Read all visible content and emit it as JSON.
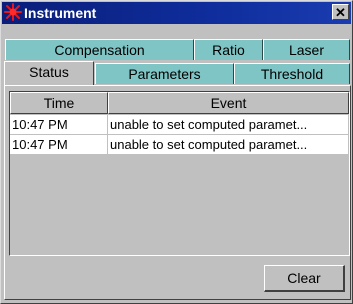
{
  "window": {
    "title": "Instrument",
    "close_symbol": "✕",
    "icon": "red-starburst-icon"
  },
  "tabs": {
    "row_back": [
      {
        "label": "Compensation"
      },
      {
        "label": "Ratio"
      },
      {
        "label": "Laser"
      }
    ],
    "row_front": [
      {
        "label": "Status",
        "active": true
      },
      {
        "label": "Parameters"
      },
      {
        "label": "Threshold"
      }
    ]
  },
  "table": {
    "columns": [
      "Time",
      "Event"
    ],
    "rows": [
      {
        "time": "10:47 PM",
        "event": "unable to set computed paramet..."
      },
      {
        "time": "10:47 PM",
        "event": "unable to set computed paramet..."
      }
    ]
  },
  "buttons": {
    "clear_label": "Clear"
  },
  "colors": {
    "titlebar": "#0f2d9c",
    "tab_inactive": "#7fc5c5",
    "face": "#c0c0c0"
  }
}
